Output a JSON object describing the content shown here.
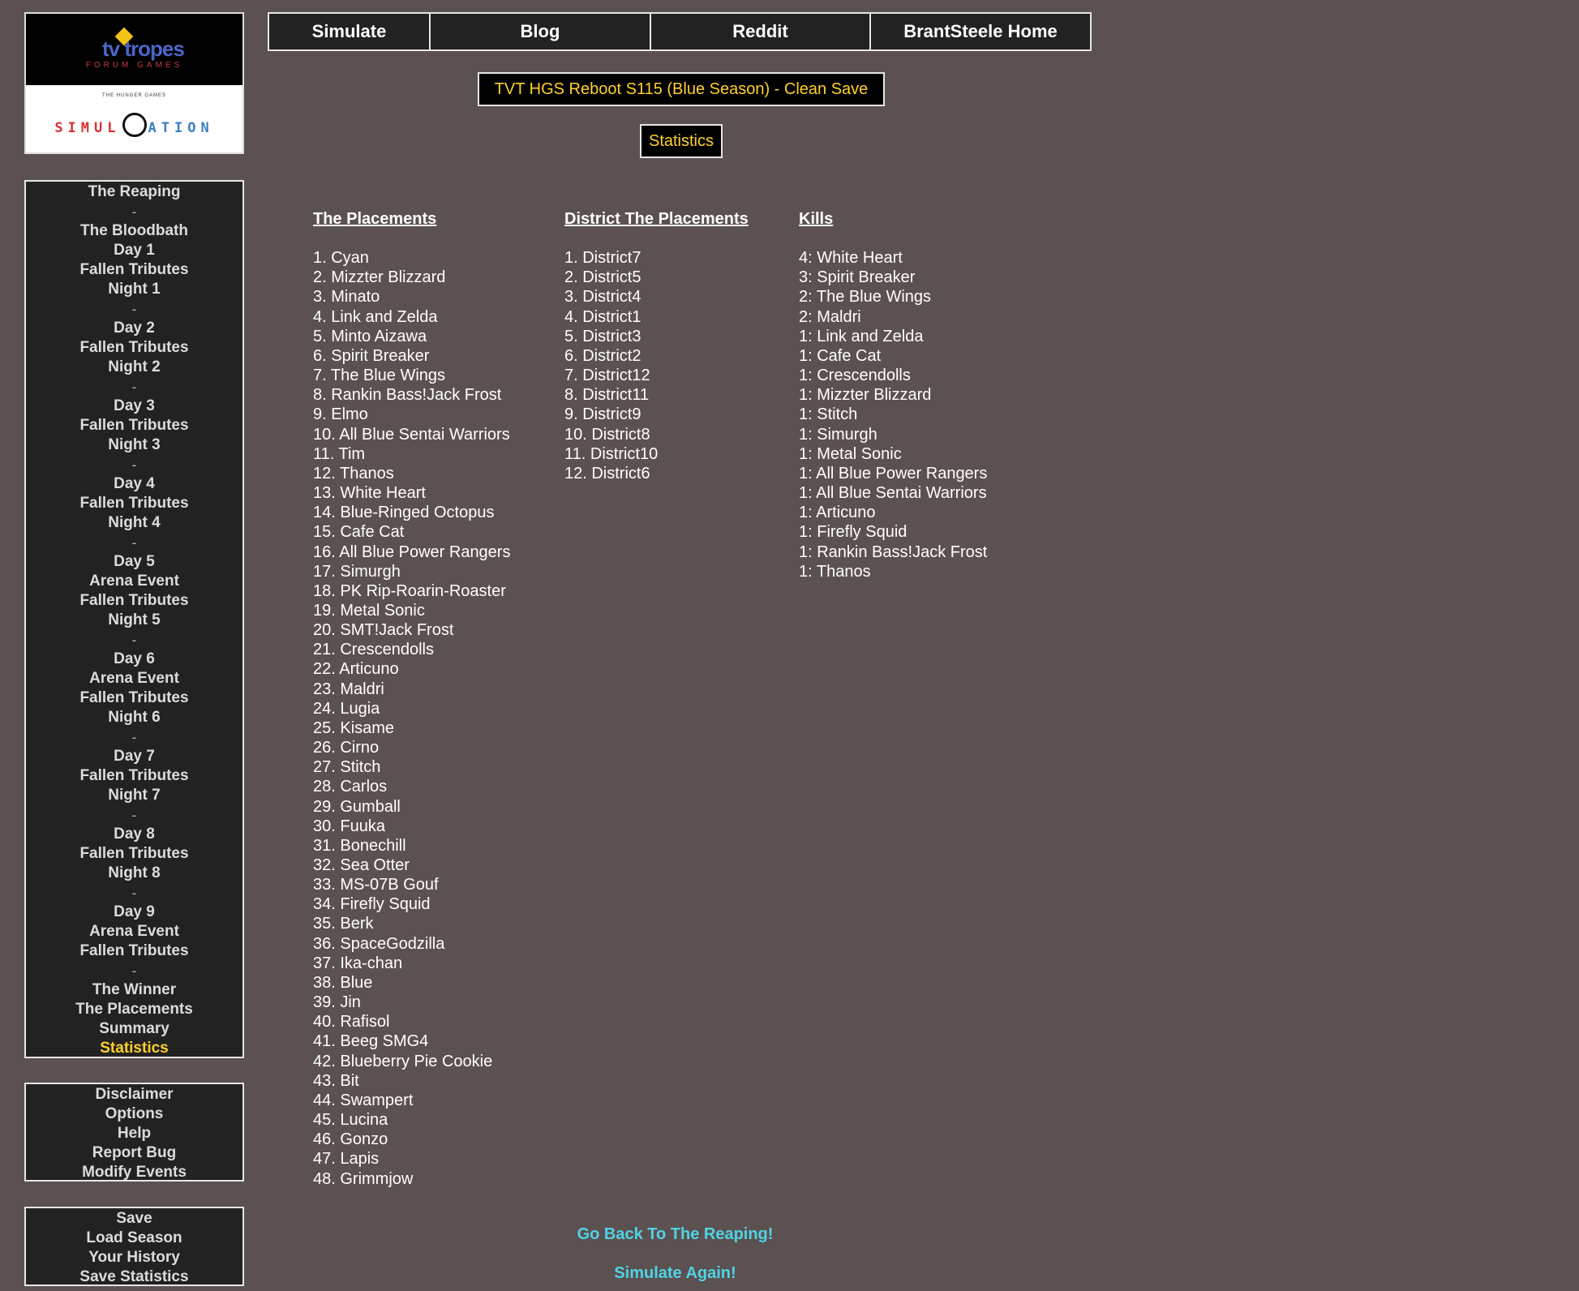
{
  "logo": {
    "tv_text": "tv tropes",
    "forum_text": "FORUM GAMES",
    "hg_text": "THE HUNGER GAMES",
    "sim_left": "SIMUL",
    "sim_right": "ATION"
  },
  "topnav": [
    "Simulate",
    "Blog",
    "Reddit",
    "BrantSteele Home"
  ],
  "season_title": "TVT HGS Reboot S115 (Blue Season) - Clean Save",
  "page_title": "Statistics",
  "nav_panel": [
    {
      "label": "The Reaping"
    },
    {
      "label": "-"
    },
    {
      "label": "The Bloodbath"
    },
    {
      "label": "Day 1"
    },
    {
      "label": "Fallen Tributes"
    },
    {
      "label": "Night 1"
    },
    {
      "label": "-"
    },
    {
      "label": "Day 2"
    },
    {
      "label": "Fallen Tributes"
    },
    {
      "label": "Night 2"
    },
    {
      "label": "-"
    },
    {
      "label": "Day 3"
    },
    {
      "label": "Fallen Tributes"
    },
    {
      "label": "Night 3"
    },
    {
      "label": "-"
    },
    {
      "label": "Day 4"
    },
    {
      "label": "Fallen Tributes"
    },
    {
      "label": "Night 4"
    },
    {
      "label": "-"
    },
    {
      "label": "Day 5"
    },
    {
      "label": "Arena Event"
    },
    {
      "label": "Fallen Tributes"
    },
    {
      "label": "Night 5"
    },
    {
      "label": "-"
    },
    {
      "label": "Day 6"
    },
    {
      "label": "Arena Event"
    },
    {
      "label": "Fallen Tributes"
    },
    {
      "label": "Night 6"
    },
    {
      "label": "-"
    },
    {
      "label": "Day 7"
    },
    {
      "label": "Fallen Tributes"
    },
    {
      "label": "Night 7"
    },
    {
      "label": "-"
    },
    {
      "label": "Day 8"
    },
    {
      "label": "Fallen Tributes"
    },
    {
      "label": "Night 8"
    },
    {
      "label": "-"
    },
    {
      "label": "Day 9"
    },
    {
      "label": "Arena Event"
    },
    {
      "label": "Fallen Tributes"
    },
    {
      "label": "-"
    },
    {
      "label": "The Winner"
    },
    {
      "label": "The Placements"
    },
    {
      "label": "Summary"
    },
    {
      "label": "Statistics",
      "active": true
    }
  ],
  "options_panel": [
    "Disclaimer",
    "Options",
    "Help",
    "Report Bug",
    "Modify Events"
  ],
  "save_panel": [
    "Save",
    "Load Season",
    "Your History",
    "Save Statistics"
  ],
  "columns": {
    "placements": {
      "heading": "The Placements",
      "rows": [
        "1. Cyan",
        "2. Mizzter Blizzard",
        "3. Minato",
        "4. Link and Zelda",
        "5. Minto Aizawa",
        "6. Spirit Breaker",
        "7. The Blue Wings",
        "8. Rankin Bass!Jack Frost",
        "9. Elmo",
        "10. All Blue Sentai Warriors",
        "11. Tim",
        "12. Thanos",
        "13. White Heart",
        "14. Blue-Ringed Octopus",
        "15. Cafe Cat",
        "16. All Blue Power Rangers",
        "17. Simurgh",
        "18. PK Rip-Roarin-Roaster",
        "19. Metal Sonic",
        "20. SMT!Jack Frost",
        "21. Crescendolls",
        "22. Articuno",
        "23. Maldri",
        "24. Lugia",
        "25. Kisame",
        "26. Cirno",
        "27. Stitch",
        "28. Carlos",
        "29. Gumball",
        "30. Fuuka",
        "31. Bonechill",
        "32. Sea Otter",
        "33. MS-07B Gouf",
        "34. Firefly Squid",
        "35. Berk",
        "36. SpaceGodzilla",
        "37. Ika-chan",
        "38. Blue",
        "39. Jin",
        "40. Rafisol",
        "41. Beeg SMG4",
        "42. Blueberry Pie Cookie",
        "43. Bit",
        "44. Swampert",
        "45. Lucina",
        "46. Gonzo",
        "47. Lapis",
        "48. Grimmjow"
      ]
    },
    "district": {
      "heading": "District The Placements",
      "rows": [
        "1. District7",
        "2. District5",
        "3. District4",
        "4. District1",
        "5. District3",
        "6. District2",
        "7. District12",
        "8. District11",
        "9. District9",
        "10. District8",
        "11. District10",
        "12. District6"
      ]
    },
    "kills": {
      "heading": "Kills",
      "rows": [
        "4: White Heart",
        "3: Spirit Breaker",
        "2: The Blue Wings",
        "2: Maldri",
        "1: Link and Zelda",
        "1: Cafe Cat",
        "1: Crescendolls",
        "1: Mizzter Blizzard",
        "1: Stitch",
        "1: Simurgh",
        "1: Metal Sonic",
        "1: All Blue Power Rangers",
        "1: All Blue Sentai Warriors",
        "1: Articuno",
        "1: Firefly Squid",
        "1: Rankin Bass!Jack Frost",
        "1: Thanos"
      ]
    }
  },
  "bottom_links": {
    "back": "Go Back To The Reaping!",
    "again": "Simulate Again!"
  },
  "colors": {
    "background": "#5b5150",
    "panel": "#222222",
    "accent_yellow": "#ffd02a",
    "link_cyan": "#4fd3e6"
  }
}
